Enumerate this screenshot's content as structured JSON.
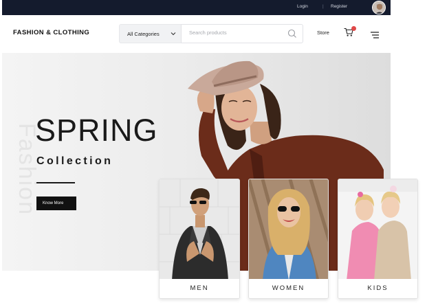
{
  "topbar": {
    "login": "Login",
    "separator": "|",
    "register": "Register"
  },
  "header": {
    "logo": "FASHION & CLOTHING",
    "category_select": "All Categories",
    "search_placeholder": "Search products",
    "store": "Store"
  },
  "hero": {
    "watermark": "Fashion",
    "title": "SPRING",
    "subtitle": "Collection",
    "cta": "Know More"
  },
  "categories": [
    {
      "label": "MEN"
    },
    {
      "label": "WOMEN"
    },
    {
      "label": "KIDS"
    }
  ],
  "colors": {
    "topbar": "#141b2d",
    "accent": "#111111",
    "badge": "#e04848"
  },
  "icons": [
    "user-avatar-icon",
    "chevron-down-icon",
    "search-icon",
    "cart-icon",
    "hamburger-menu-icon"
  ]
}
